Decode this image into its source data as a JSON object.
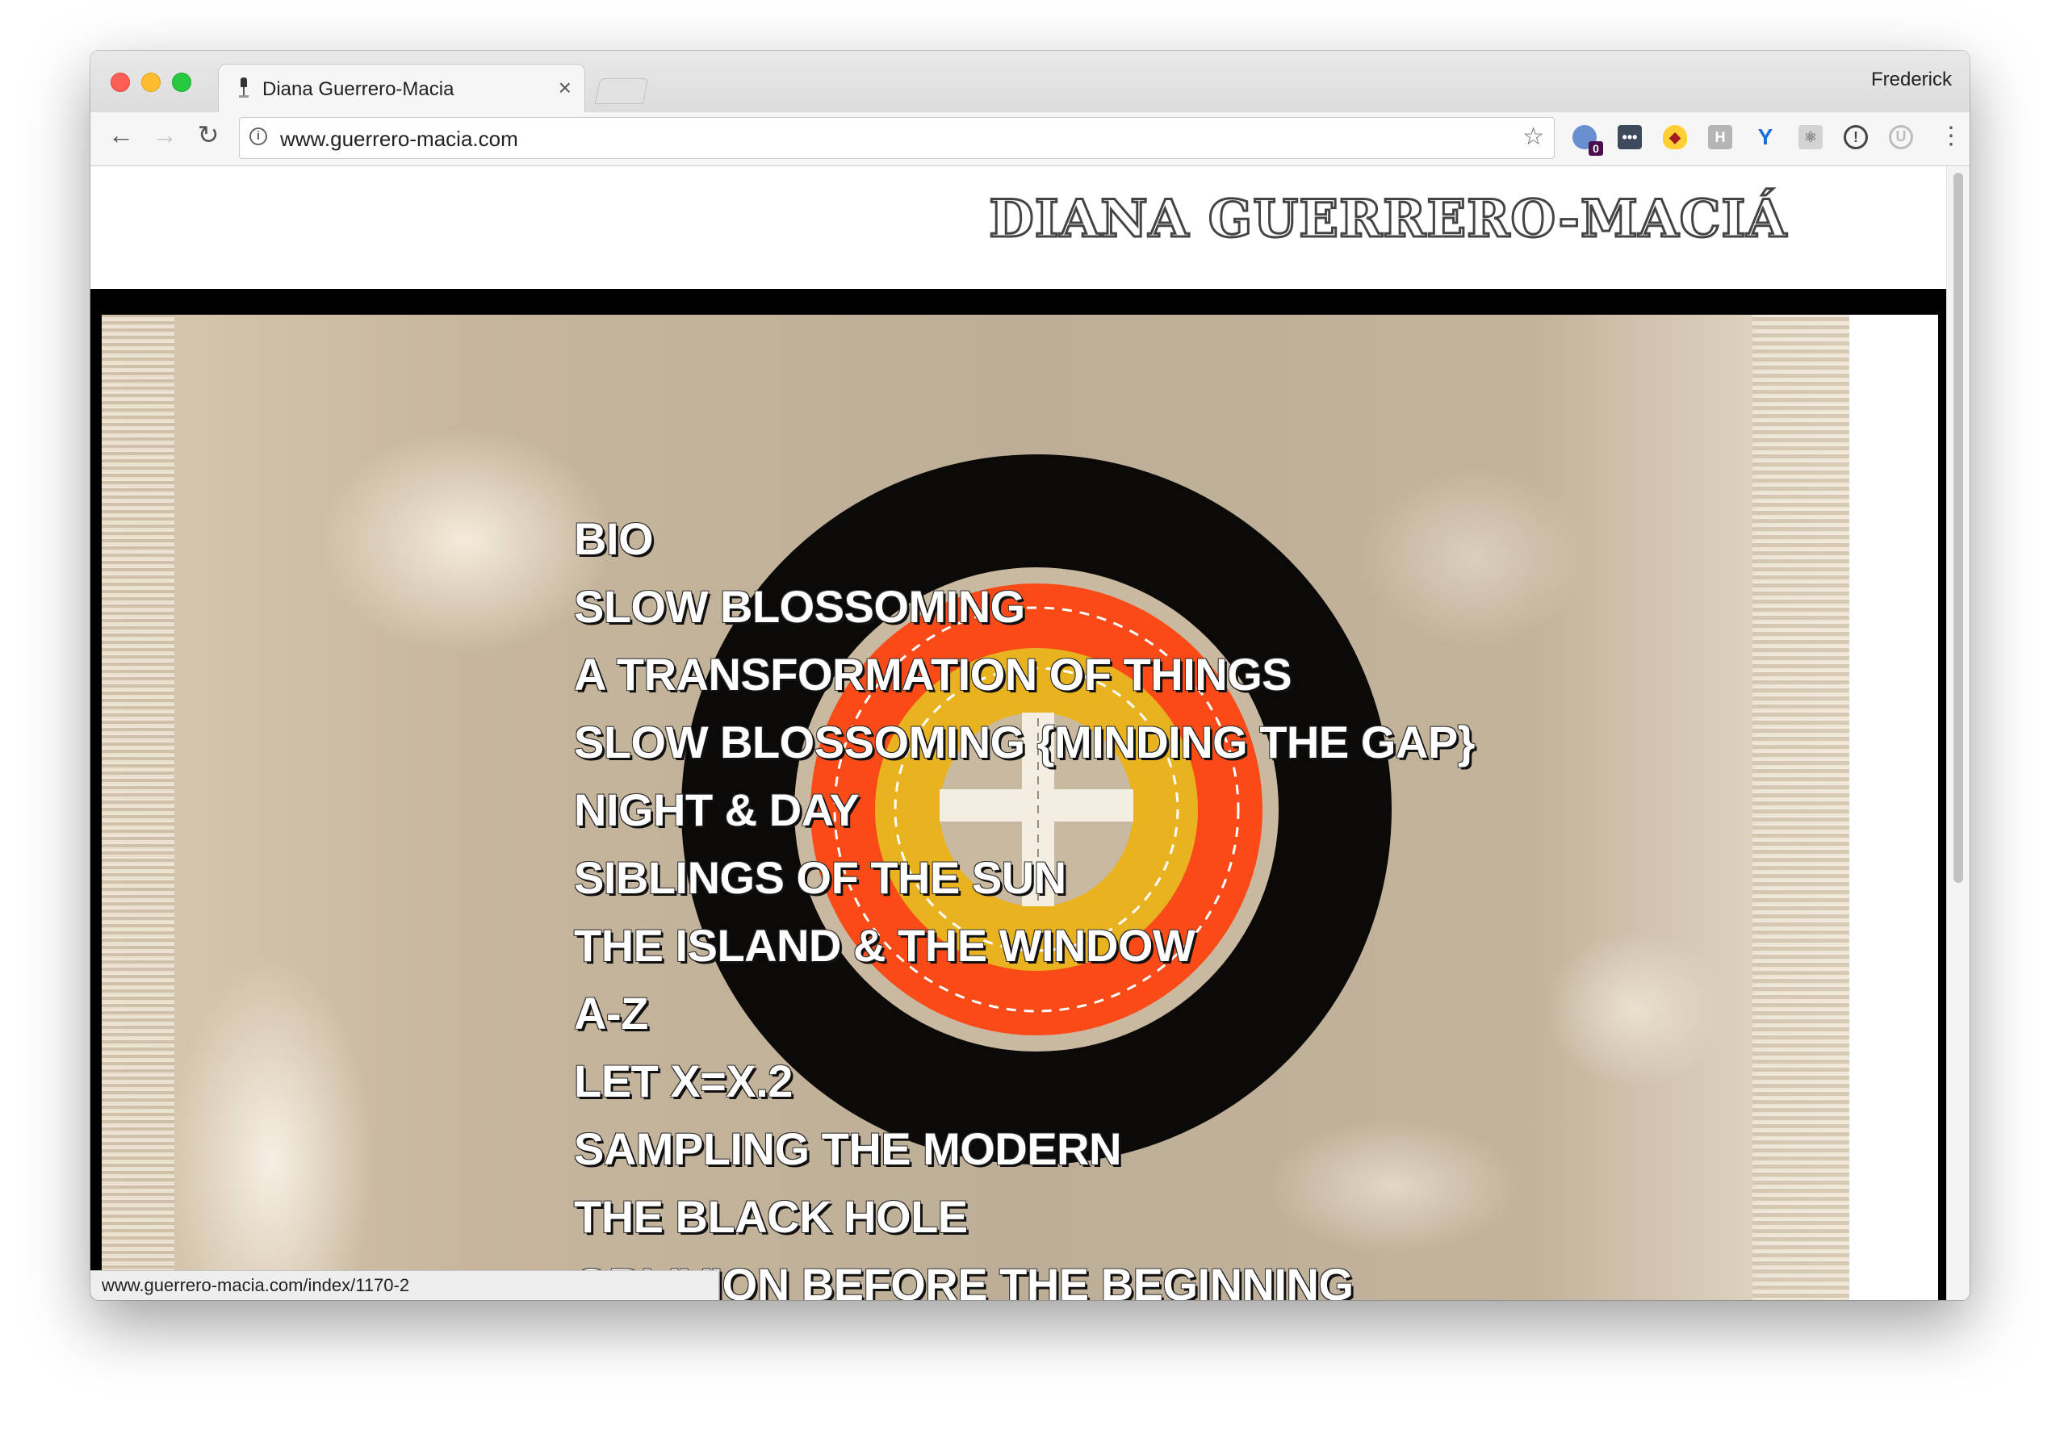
{
  "browser": {
    "tab_title": "Diana Guerrero-Macia",
    "tab_close_glyph": "×",
    "profile_name": "Frederick",
    "url": "www.guerrero-macia.com",
    "status_url": "www.guerrero-macia.com/index/1170-2",
    "extensions": [
      {
        "name": "ghostery-icon",
        "badge": "0"
      },
      {
        "name": "lastpass-icon",
        "glyph": "•••"
      },
      {
        "name": "cookie-cat-icon",
        "glyph": "◆"
      },
      {
        "name": "h-extension-icon",
        "glyph": "H"
      },
      {
        "name": "y-extension-icon",
        "glyph": "Y"
      },
      {
        "name": "react-devtools-icon",
        "glyph": "⚛"
      },
      {
        "name": "onepassword-icon",
        "glyph": "!"
      },
      {
        "name": "u-extension-icon",
        "glyph": "U"
      }
    ],
    "nav_glyphs": {
      "back": "←",
      "forward": "→",
      "reload": "↻",
      "star": "☆",
      "menu": "⋮",
      "info": "i"
    }
  },
  "site": {
    "title": "DIANA GUERRERO-MACIÁ",
    "nav_items": [
      "BIO",
      "SLOW BLOSSOMING",
      "A TRANSFORMATION OF THINGS",
      "SLOW BLOSSOMING {MINDING THE GAP}",
      "NIGHT & DAY",
      "SIBLINGS OF THE SUN",
      "THE ISLAND & THE WINDOW",
      "A-Z",
      "LET X=X.2",
      "SAMPLING THE MODERN",
      "THE BLACK HOLE",
      "OBLIVION BEFORE THE BEGINNING"
    ]
  },
  "colors": {
    "target_black": "#0c0a09",
    "target_red": "#fa4a17",
    "target_yellow": "#e9b320",
    "target_linen": "#cab9a1",
    "target_cross": "#f3ede2"
  }
}
